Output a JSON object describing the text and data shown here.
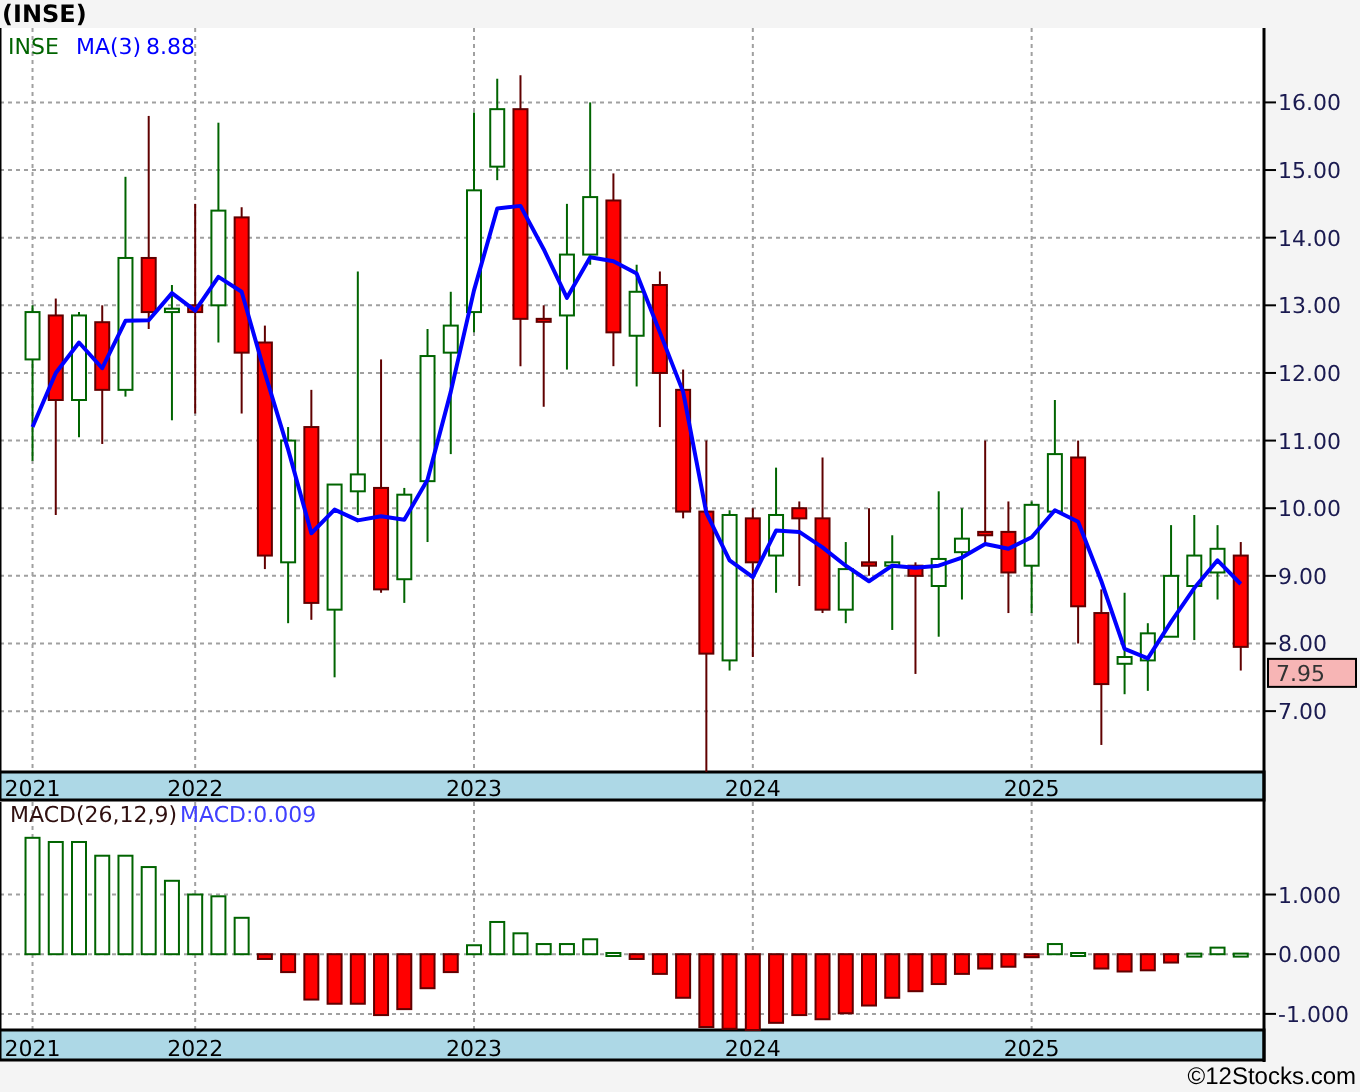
{
  "title": "(INSE)",
  "price_panel": {
    "symbol": "INSE",
    "indicator_value": "8.88",
    "last_price": "7.95",
    "chart_data": {
      "type": "candlestick",
      "grid": true,
      "ylim": [
        6.1,
        17.1
      ],
      "categories": [
        "2021",
        null,
        null,
        null,
        null,
        null,
        null,
        "2022",
        null,
        null,
        null,
        null,
        null,
        null,
        null,
        null,
        null,
        null,
        null,
        "2023",
        null,
        null,
        null,
        null,
        null,
        null,
        null,
        null,
        null,
        null,
        null,
        "2024",
        null,
        null,
        null,
        null,
        null,
        null,
        null,
        null,
        null,
        null,
        null,
        "2025",
        null,
        null,
        null,
        null,
        null,
        null,
        null,
        null,
        null
      ],
      "yticks": [
        {
          "value": 7,
          "label": "7.00"
        },
        {
          "value": 8,
          "label": "8.00"
        },
        {
          "value": 9,
          "label": "9.00"
        },
        {
          "value": 10,
          "label": "10.00"
        },
        {
          "value": 11,
          "label": "11.00"
        },
        {
          "value": 12,
          "label": "12.00"
        },
        {
          "value": 13,
          "label": "13.00"
        },
        {
          "value": 14,
          "label": "14.00"
        },
        {
          "value": 15,
          "label": "15.00"
        },
        {
          "value": 16,
          "label": "16.00"
        }
      ],
      "ohlc": [
        [
          12.2,
          13.0,
          10.7,
          12.9
        ],
        [
          12.85,
          13.1,
          9.9,
          11.6
        ],
        [
          11.6,
          12.9,
          11.05,
          12.85
        ],
        [
          12.75,
          13.0,
          10.95,
          11.75
        ],
        [
          11.75,
          14.9,
          11.65,
          13.7
        ],
        [
          13.7,
          15.8,
          12.65,
          12.9
        ],
        [
          12.9,
          13.3,
          11.3,
          12.95
        ],
        [
          13.0,
          14.5,
          11.4,
          12.9
        ],
        [
          13.0,
          15.7,
          12.45,
          14.4
        ],
        [
          14.3,
          14.45,
          11.4,
          12.3
        ],
        [
          12.45,
          12.7,
          9.1,
          9.3
        ],
        [
          9.2,
          11.2,
          8.3,
          11.0
        ],
        [
          11.2,
          11.75,
          8.35,
          8.6
        ],
        [
          8.5,
          10.35,
          7.5,
          10.35
        ],
        [
          10.25,
          13.5,
          9.9,
          10.5
        ],
        [
          10.3,
          12.2,
          8.75,
          8.8
        ],
        [
          8.95,
          10.3,
          8.6,
          10.2
        ],
        [
          10.4,
          12.65,
          9.5,
          12.25
        ],
        [
          12.3,
          13.2,
          10.8,
          12.7
        ],
        [
          12.9,
          15.85,
          12.6,
          14.7
        ],
        [
          15.05,
          16.35,
          14.85,
          15.9
        ],
        [
          15.9,
          16.4,
          12.1,
          12.8
        ],
        [
          12.8,
          13.0,
          11.5,
          12.78
        ],
        [
          12.85,
          14.5,
          12.05,
          13.75
        ],
        [
          13.75,
          16.0,
          13.6,
          14.6
        ],
        [
          14.55,
          14.95,
          12.1,
          12.6
        ],
        [
          12.55,
          13.6,
          11.8,
          13.2
        ],
        [
          13.3,
          13.5,
          11.2,
          12.0
        ],
        [
          11.75,
          12.05,
          9.85,
          9.95
        ],
        [
          9.95,
          11.0,
          6.1,
          7.85
        ],
        [
          7.75,
          9.97,
          7.6,
          9.9
        ],
        [
          9.85,
          10.0,
          7.8,
          9.2
        ],
        [
          9.3,
          10.6,
          8.75,
          9.9
        ],
        [
          10.0,
          10.1,
          8.85,
          9.85
        ],
        [
          9.85,
          10.75,
          8.45,
          8.5
        ],
        [
          8.5,
          9.5,
          8.3,
          9.1
        ],
        [
          9.2,
          10.0,
          9.0,
          9.15
        ],
        [
          9.15,
          9.6,
          8.2,
          9.2
        ],
        [
          9.15,
          9.2,
          7.55,
          9.0
        ],
        [
          8.85,
          10.25,
          8.1,
          9.25
        ],
        [
          9.35,
          10.0,
          8.65,
          9.55
        ],
        [
          9.65,
          11.0,
          9.45,
          9.6
        ],
        [
          9.65,
          10.1,
          8.45,
          9.05
        ],
        [
          9.15,
          10.1,
          8.45,
          10.05
        ],
        [
          9.95,
          11.6,
          9.95,
          10.8
        ],
        [
          10.75,
          11.0,
          8.0,
          8.55
        ],
        [
          8.45,
          8.8,
          6.5,
          7.4
        ],
        [
          7.7,
          8.75,
          7.25,
          7.8
        ],
        [
          7.75,
          8.3,
          7.3,
          8.15
        ],
        [
          8.1,
          9.75,
          8.1,
          9.0
        ],
        [
          8.85,
          9.9,
          8.05,
          9.3
        ],
        [
          9.05,
          9.75,
          8.65,
          9.4
        ],
        [
          9.3,
          9.5,
          7.6,
          7.95
        ]
      ],
      "series": [
        {
          "name": "MA(3)",
          "type": "line",
          "color": "#0000ff",
          "values": [
            11.2,
            12.0,
            12.45,
            12.07,
            12.77,
            12.78,
            13.18,
            12.92,
            13.42,
            13.2,
            12.0,
            10.87,
            9.63,
            9.98,
            9.82,
            9.88,
            9.83,
            10.42,
            11.72,
            13.22,
            14.43,
            14.47,
            13.83,
            13.11,
            13.71,
            13.65,
            13.47,
            12.6,
            11.72,
            9.93,
            9.23,
            8.98,
            9.67,
            9.65,
            9.42,
            9.15,
            8.92,
            9.15,
            9.12,
            9.15,
            9.27,
            9.47,
            9.4,
            9.57,
            9.97,
            9.8,
            8.92,
            7.92,
            7.78,
            8.32,
            8.82,
            9.23,
            8.88
          ]
        }
      ]
    }
  },
  "macd_panel": {
    "indicator_value": "MACD:0.009",
    "chart_data": {
      "type": "bar",
      "grid": true,
      "ylim": [
        -1.27,
        2.55
      ],
      "categories": [
        "2021",
        null,
        null,
        null,
        null,
        null,
        null,
        "2022",
        null,
        null,
        null,
        null,
        null,
        null,
        null,
        null,
        null,
        null,
        null,
        "2023",
        null,
        null,
        null,
        null,
        null,
        null,
        null,
        null,
        null,
        null,
        null,
        "2024",
        null,
        null,
        null,
        null,
        null,
        null,
        null,
        null,
        null,
        null,
        null,
        "2025",
        null,
        null,
        null,
        null,
        null,
        null,
        null,
        null,
        null
      ],
      "yticks": [
        {
          "value": -1,
          "label": "-1.000"
        },
        {
          "value": 0,
          "label": "0.000"
        },
        {
          "value": 1,
          "label": "1.000"
        }
      ],
      "series": [
        {
          "name": "MACD(26,12,9)",
          "values": [
            1.95,
            1.88,
            1.88,
            1.65,
            1.65,
            1.46,
            1.23,
            1.0,
            0.97,
            0.61,
            -0.08,
            -0.3,
            -0.76,
            -0.83,
            -0.83,
            -1.02,
            -0.92,
            -0.57,
            -0.3,
            0.15,
            0.54,
            0.35,
            0.17,
            0.17,
            0.25,
            0.02,
            -0.08,
            -0.33,
            -0.73,
            -1.22,
            -1.25,
            -1.27,
            -1.15,
            -1.02,
            -1.09,
            -0.99,
            -0.86,
            -0.73,
            -0.62,
            -0.5,
            -0.33,
            -0.24,
            -0.21,
            -0.03,
            0.17,
            0.02,
            -0.24,
            -0.29,
            -0.27,
            -0.14,
            0.01,
            0.11,
            0.01
          ]
        }
      ]
    }
  },
  "footer": "©12Stocks.com"
}
